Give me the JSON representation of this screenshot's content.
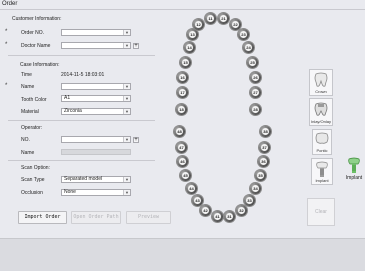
{
  "window": {
    "title": "Order"
  },
  "customer": {
    "section": "Customer Information:",
    "order_no_label": "Order NO.",
    "doctor_label": "Doctor Name",
    "plus": "+"
  },
  "case": {
    "section": "Case Information:",
    "time_label": "Time",
    "time_value": "2014-11-5 18:03:01",
    "name_label": "Name",
    "tooth_color_label": "Tooth Color",
    "tooth_color_value": "A1",
    "material_label": "Material",
    "material_value": "Zirconia"
  },
  "operator": {
    "section": "Operator:",
    "no_label": "NO.",
    "name_label": "Name"
  },
  "scan": {
    "section": "Scan Option:",
    "scan_type_label": "Scan Type",
    "scan_type_value": "Separated model",
    "occlusion_label": "Occlusion",
    "occlusion_value": "None"
  },
  "buttons": {
    "import_order": "Import Order",
    "open_order_path": "Open Order Path",
    "preview": "Preview",
    "clear": "Clear"
  },
  "tooth_types": [
    {
      "label": "Crown",
      "icon": "crown-icon"
    },
    {
      "label": "Inlay/Onlay",
      "icon": "inlay-onlay-icon"
    },
    {
      "label": "Pontic",
      "icon": "pontic-icon"
    },
    {
      "label": "Implant",
      "icon": "implant-icon"
    }
  ],
  "implant_extra": {
    "label": "Implant",
    "icon": "implant-green-icon"
  },
  "upper_teeth": [
    "18",
    "17",
    "16",
    "15",
    "14",
    "13",
    "12",
    "11",
    "21",
    "22",
    "23",
    "24",
    "25",
    "26",
    "27",
    "28"
  ],
  "lower_teeth": [
    "48",
    "47",
    "46",
    "45",
    "44",
    "43",
    "42",
    "41",
    "31",
    "32",
    "33",
    "34",
    "35",
    "36",
    "37",
    "38"
  ],
  "required_marker": "*",
  "dropdown_arrow": "▼"
}
